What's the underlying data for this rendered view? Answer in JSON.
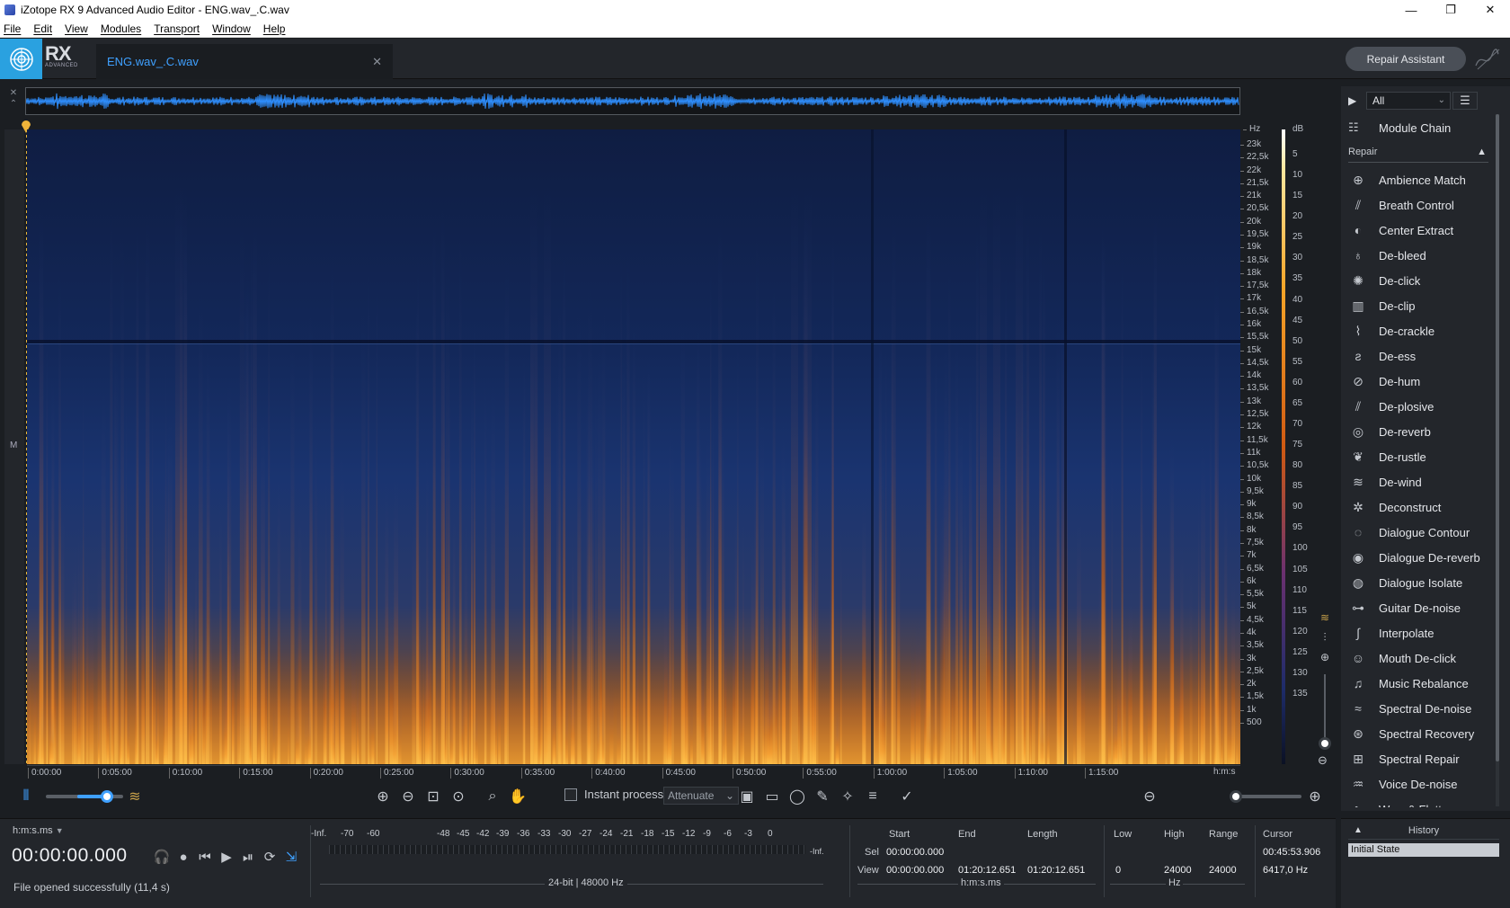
{
  "window": {
    "title": "iZotope RX 9 Advanced Audio Editor - ENG.wav_.C.wav",
    "minimize": "—",
    "maximize": "❐",
    "close": "✕"
  },
  "menu": [
    "File",
    "Edit",
    "View",
    "Modules",
    "Transport",
    "Window",
    "Help"
  ],
  "header": {
    "logo_text": "RX",
    "logo_sub": "ADVANCED",
    "file_tab": "ENG.wav_.C.wav",
    "file_tab_close": "✕",
    "repair_assistant": "Repair Assistant"
  },
  "spectrogram": {
    "channel_label": "M",
    "hz_unit": "Hz",
    "hz_ticks": [
      "23k",
      "22,5k",
      "22k",
      "21,5k",
      "21k",
      "20,5k",
      "20k",
      "19,5k",
      "19k",
      "18,5k",
      "18k",
      "17,5k",
      "17k",
      "16,5k",
      "16k",
      "15,5k",
      "15k",
      "14,5k",
      "14k",
      "13,5k",
      "13k",
      "12,5k",
      "12k",
      "11,5k",
      "11k",
      "10,5k",
      "10k",
      "9,5k",
      "9k",
      "8,5k",
      "8k",
      "7,5k",
      "7k",
      "6,5k",
      "6k",
      "5,5k",
      "5k",
      "4,5k",
      "4k",
      "3,5k",
      "3k",
      "2,5k",
      "2k",
      "1,5k",
      "1k",
      "500"
    ],
    "db_unit": "dB",
    "db_ticks": [
      "5",
      "10",
      "15",
      "20",
      "25",
      "30",
      "35",
      "40",
      "45",
      "50",
      "55",
      "60",
      "65",
      "70",
      "75",
      "80",
      "85",
      "90",
      "95",
      "100",
      "105",
      "110",
      "115",
      "120",
      "125",
      "130",
      "135"
    ],
    "time_ticks": [
      "0:00:00",
      "0:05:00",
      "0:10:00",
      "0:15:00",
      "0:20:00",
      "0:25:00",
      "0:30:00",
      "0:35:00",
      "0:40:00",
      "0:45:00",
      "0:50:00",
      "0:55:00",
      "1:00:00",
      "1:05:00",
      "1:10:00",
      "1:15:00"
    ],
    "time_unit": "h:m:s",
    "colors": {
      "low": "#0d1a3a",
      "mid": "#1c3a7a",
      "high": "#f08a20",
      "peak": "#ffd060"
    }
  },
  "toolbar": {
    "instant_process": "Instant process",
    "attenuate": "Attenuate",
    "attenuate_arrow": "⌄",
    "waveform_zoom_level": 0.85,
    "time_zoom_level": 0.0
  },
  "transport": {
    "time_format": "h:m:s.ms",
    "time_format_arrow": "▼",
    "timecode": "00:00:00.000",
    "status": "File opened successfully (11,4 s)",
    "buttons": [
      "headphones-icon",
      "record-icon",
      "skip-back-icon",
      "play-icon",
      "play-selection-icon",
      "loop-icon",
      "follow-icon"
    ]
  },
  "meter": {
    "ticks": [
      "-Inf.",
      "-70",
      "-60",
      "-48",
      "-45",
      "-42",
      "-39",
      "-36",
      "-33",
      "-30",
      "-27",
      "-24",
      "-21",
      "-18",
      "-15",
      "-12",
      "-9",
      "-6",
      "-3",
      "0"
    ],
    "inf_right": "-Inf.",
    "info": "24-bit | 48000 Hz"
  },
  "selection": {
    "start_label": "Start",
    "end_label": "End",
    "length_label": "Length",
    "sel_label": "Sel",
    "view_label": "View",
    "sel_start": "00:00:00.000",
    "view_start": "00:00:00.000",
    "view_end": "01:20:12.651",
    "view_length": "01:20:12.651",
    "unit": "h:m:s.ms"
  },
  "frequency": {
    "low_label": "Low",
    "high_label": "High",
    "range_label": "Range",
    "low": "0",
    "high": "24000",
    "range": "24000",
    "unit": "Hz"
  },
  "cursor": {
    "label": "Cursor",
    "time": "00:45:53.906",
    "freq": "6417,0 Hz"
  },
  "right_panel": {
    "filter": "All",
    "filter_arrow": "⌄",
    "menu_icon": "☰",
    "module_chain": "Module Chain",
    "section": "Repair",
    "modules": [
      {
        "label": "Ambience Match",
        "icon": "ambience-match-icon",
        "glyph": "⊕"
      },
      {
        "label": "Breath Control",
        "icon": "breath-control-icon",
        "glyph": "⫽"
      },
      {
        "label": "Center Extract",
        "icon": "center-extract-icon",
        "glyph": "◐"
      },
      {
        "label": "De-bleed",
        "icon": "de-bleed-icon",
        "glyph": "♁"
      },
      {
        "label": "De-click",
        "icon": "de-click-icon",
        "glyph": "✺"
      },
      {
        "label": "De-clip",
        "icon": "de-clip-icon",
        "glyph": "▥"
      },
      {
        "label": "De-crackle",
        "icon": "de-crackle-icon",
        "glyph": "⌇"
      },
      {
        "label": "De-ess",
        "icon": "de-ess-icon",
        "glyph": "ƨ"
      },
      {
        "label": "De-hum",
        "icon": "de-hum-icon",
        "glyph": "⊘"
      },
      {
        "label": "De-plosive",
        "icon": "de-plosive-icon",
        "glyph": "⫽"
      },
      {
        "label": "De-reverb",
        "icon": "de-reverb-icon",
        "glyph": "◎"
      },
      {
        "label": "De-rustle",
        "icon": "de-rustle-icon",
        "glyph": "❦"
      },
      {
        "label": "De-wind",
        "icon": "de-wind-icon",
        "glyph": "≋"
      },
      {
        "label": "Deconstruct",
        "icon": "deconstruct-icon",
        "glyph": "✲"
      },
      {
        "label": "Dialogue Contour",
        "icon": "dialogue-contour-icon",
        "glyph": "◌"
      },
      {
        "label": "Dialogue De-reverb",
        "icon": "dialogue-de-reverb-icon",
        "glyph": "◉"
      },
      {
        "label": "Dialogue Isolate",
        "icon": "dialogue-isolate-icon",
        "glyph": "◍"
      },
      {
        "label": "Guitar De-noise",
        "icon": "guitar-de-noise-icon",
        "glyph": "⊶"
      },
      {
        "label": "Interpolate",
        "icon": "interpolate-icon",
        "glyph": "∫"
      },
      {
        "label": "Mouth De-click",
        "icon": "mouth-de-click-icon",
        "glyph": "☺"
      },
      {
        "label": "Music Rebalance",
        "icon": "music-rebalance-icon",
        "glyph": "♫"
      },
      {
        "label": "Spectral De-noise",
        "icon": "spectral-de-noise-icon",
        "glyph": "≈"
      },
      {
        "label": "Spectral Recovery",
        "icon": "spectral-recovery-icon",
        "glyph": "⊛"
      },
      {
        "label": "Spectral Repair",
        "icon": "spectral-repair-icon",
        "glyph": "⊞"
      },
      {
        "label": "Voice De-noise",
        "icon": "voice-de-noise-icon",
        "glyph": "♒"
      },
      {
        "label": "Wow & Flutter",
        "icon": "wow-flutter-icon",
        "glyph": "∿"
      }
    ]
  },
  "history": {
    "title": "History",
    "items": [
      "Initial State"
    ]
  }
}
